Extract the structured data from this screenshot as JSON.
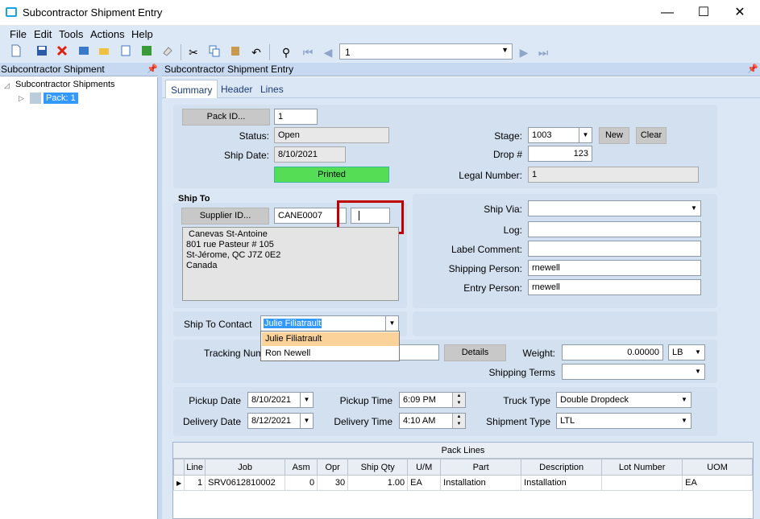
{
  "window": {
    "title": "Subcontractor Shipment Entry",
    "minimize": "—",
    "maximize": "☐",
    "close": "✕"
  },
  "menu": [
    "File",
    "Edit",
    "Tools",
    "Actions",
    "Help"
  ],
  "nav": {
    "value": "1"
  },
  "left_pane": {
    "header": "Subcontractor Shipment",
    "tree_root": "Subcontractor Shipments",
    "tree_child": "Pack: 1"
  },
  "right_pane": {
    "header": "Subcontractor Shipment Entry"
  },
  "tabs": [
    "Summary",
    "Header",
    "Lines"
  ],
  "summary": {
    "pack_id_button": "Pack ID...",
    "pack_id": "1",
    "status_label": "Status:",
    "status": "Open",
    "ship_date_label": "Ship Date:",
    "ship_date": "8/10/2021",
    "printed": "Printed",
    "stage_label": "Stage:",
    "stage": "1003",
    "new_button": "New",
    "clear_button": "Clear",
    "drop_label": "Drop #",
    "drop": "123",
    "legal_label": "Legal Number:",
    "legal": "1"
  },
  "ship_to": {
    "heading": "Ship To",
    "supplier_button": "Supplier ID...",
    "supplier_id": "CANE0007",
    "address": [
      "Canevas St-Antoine",
      "801 rue Pasteur # 105",
      "St-Jérome, QC  J7Z 0E2",
      "Canada"
    ],
    "contact_label": "Ship To Contact",
    "contact": "Julie Filiatrault",
    "contact_options": [
      "Julie Filiatrault",
      "Ron Newell"
    ]
  },
  "shipping": {
    "ship_via_label": "Ship Via:",
    "log_label": "Log:",
    "label_comment_label": "Label Comment:",
    "shipping_person_label": "Shipping Person:",
    "shipping_person": "rnewell",
    "entry_person_label": "Entry Person:",
    "entry_person": "rnewell"
  },
  "tracking": {
    "tracking_label": "Tracking Num",
    "details_button": "Details",
    "weight_label": "Weight:",
    "weight": "0.00000",
    "weight_uom": "LB",
    "terms_label": "Shipping Terms"
  },
  "dates": {
    "pickup_date_label": "Pickup Date",
    "pickup_date": "8/10/2021",
    "pickup_time_label": "Pickup Time",
    "pickup_time": "6:09 PM",
    "truck_type_label": "Truck Type",
    "truck_type": "Double Dropdeck",
    "delivery_date_label": "Delivery Date",
    "delivery_date": "8/12/2021",
    "delivery_time_label": "Delivery Time",
    "delivery_time": "4:10 AM",
    "shipment_type_label": "Shipment Type",
    "shipment_type": "LTL"
  },
  "pack_lines": {
    "title": "Pack Lines",
    "columns": [
      "Line",
      "Job",
      "Asm",
      "Opr",
      "Ship Qty",
      "U/M",
      "Part",
      "Description",
      "Lot Number",
      "UOM"
    ],
    "rows": [
      [
        "1",
        "SRV0612810002",
        "0",
        "30",
        "1.00",
        "EA",
        "Installation",
        "Installation",
        "",
        "EA"
      ]
    ]
  }
}
